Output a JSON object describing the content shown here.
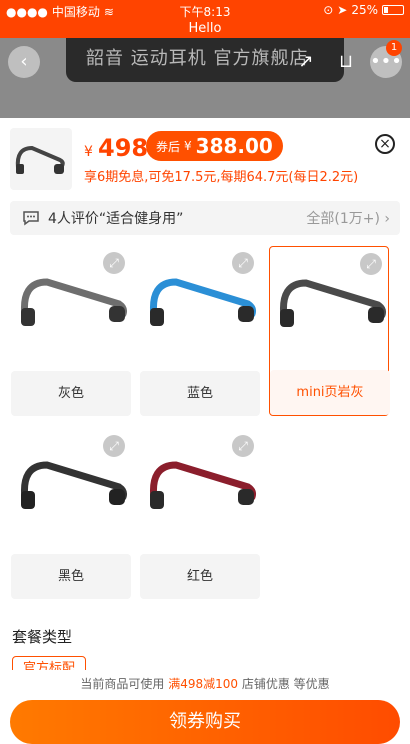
{
  "status_bar": {
    "carrier": "中国移动",
    "time": "下午8:13",
    "battery": "25%"
  },
  "hello_banner": "Hello",
  "background": {
    "title": "韶音 运动耳机 官方旗舰店",
    "cart_badge": "1"
  },
  "product": {
    "currency": "¥",
    "price": "498",
    "coupon_label": "券后",
    "coupon_currency": "¥",
    "coupon_price": "388.00",
    "installment": "享6期免息,可免17.5元,每期64.7元(每日2.2元)"
  },
  "review": {
    "text": "4人评价“适合健身用”",
    "all_label": "全部(1万+)"
  },
  "colors": {
    "accent": "#ff5000",
    "variants": [
      {
        "label": "灰色",
        "band": "#6e6e6e",
        "selected": false
      },
      {
        "label": "蓝色",
        "band": "#2b8fd6",
        "selected": false
      },
      {
        "label": "mini页岩灰",
        "band": "#5a5a5a",
        "selected": true
      },
      {
        "label": "黑色",
        "band": "#333333",
        "selected": false
      },
      {
        "label": "红色",
        "band": "#8b1e2c",
        "selected": false
      }
    ]
  },
  "package": {
    "title": "套餐类型",
    "option": "官方标配"
  },
  "promo": {
    "prefix": "当前商品可使用",
    "highlight": "满498减100",
    "suffix": "店铺优惠 等优惠"
  },
  "buy_button": "领券购买"
}
